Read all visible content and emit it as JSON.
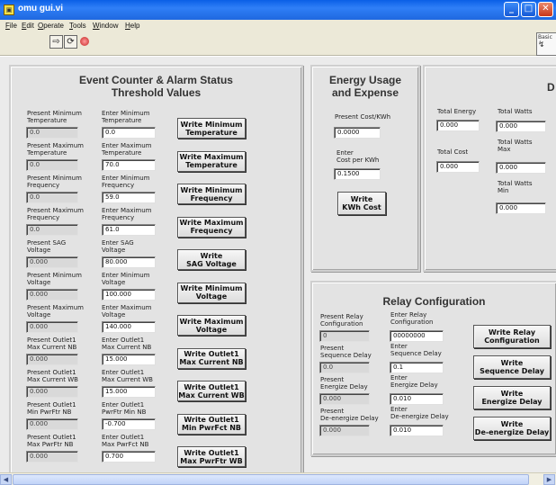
{
  "window": {
    "title": "omu gui.vi"
  },
  "menu": [
    "File",
    "Edit",
    "Operate",
    "Tools",
    "Window",
    "Help"
  ],
  "toolbar": {
    "palette_label": "Basic"
  },
  "event_panel": {
    "title": "Event Counter & Alarm Status\nThreshold Values",
    "rows": [
      {
        "present_label": "Present Minimum\nTemperature",
        "present_value": "0.0",
        "enter_label": "Enter Minimum\nTemperature",
        "enter_value": "0.0",
        "button": "Write Minimum\nTemperature"
      },
      {
        "present_label": "Present Maximum\nTemperature",
        "present_value": "0.0",
        "enter_label": "Enter Maximum\nTemperature",
        "enter_value": "70.0",
        "button": "Write Maximum\nTemperature"
      },
      {
        "present_label": "Present Minimum\nFrequency",
        "present_value": "0.0",
        "enter_label": "Enter Minimum\nFrequency",
        "enter_value": "59.0",
        "button": "Write Minimum\nFrequency"
      },
      {
        "present_label": "Present Maximum\nFrequency",
        "present_value": "0.0",
        "enter_label": "Enter Maximum\nFrequency",
        "enter_value": "61.0",
        "button": "Write Maximum\nFrequency"
      },
      {
        "present_label": "Present SAG\nVoltage",
        "present_value": "0.000",
        "enter_label": "Enter SAG\nVoltage",
        "enter_value": "80.000",
        "button": "Write\nSAG Voltage"
      },
      {
        "present_label": "Present Minimum\nVoltage",
        "present_value": "0.000",
        "enter_label": "Enter Minimum\nVoltage",
        "enter_value": "100.000",
        "button": "Write Minimum\nVoltage"
      },
      {
        "present_label": "Present Maximum\nVoltage",
        "present_value": "0.000",
        "enter_label": "Enter Maximum\nVoltage",
        "enter_value": "140.000",
        "button": "Write Maximum\nVoltage"
      },
      {
        "present_label": "Present Outlet1\nMax Current NB",
        "present_value": "0.000",
        "enter_label": "Enter Outlet1\nMax Current NB",
        "enter_value": "15.000",
        "button": "Write Outlet1\nMax Current NB"
      },
      {
        "present_label": "Present Outlet1\nMax Current WB",
        "present_value": "0.000",
        "enter_label": "Enter Outlet1\nMax Current WB",
        "enter_value": "15.000",
        "button": "Write Outlet1\nMax Current WB"
      },
      {
        "present_label": "Present Outlet1\nMin PwrFtr NB",
        "present_value": "0.000",
        "enter_label": "Enter Outlet1\nPwrFtr Min NB",
        "enter_value": "-0.700",
        "button": "Write Outlet1\nMin PwrFct NB"
      },
      {
        "present_label": "Present Outlet1\nMax PwrFtr NB",
        "present_value": "0.000",
        "enter_label": "Enter Outlet1\nMax PwrFct NB",
        "enter_value": "0.700",
        "button": "Write Outlet1\nMax PwrFtr WB"
      }
    ]
  },
  "energy_panel": {
    "title": "Energy Usage\nand Expense",
    "cost_label": "Present Cost/KWh",
    "cost_value": "0.0000",
    "enter_label": "Enter\nCost per KWh",
    "enter_value": "0.1500",
    "write_button": "Write\nKWh Cost"
  },
  "totals_panel": {
    "title_fragment": "D",
    "total_energy_label": "Total Energy",
    "total_energy_value": "0.000",
    "total_cost_label": "Total Cost",
    "total_cost_value": "0.000",
    "total_watts_label": "Total Watts",
    "total_watts_value": "0.000",
    "total_watts_max_label": "Total Watts\nMax",
    "total_watts_max_value": "0.000",
    "total_watts_min_label": "Total Watts\nMin",
    "total_watts_min_value": "0.000"
  },
  "relay_panel": {
    "title": "Relay Configuration",
    "rows": [
      {
        "present_label": "Present Relay\nConfiguration",
        "present_value": "0",
        "enter_label": "Enter Relay\nConfiguration",
        "enter_value": "00000000",
        "button": "Write Relay\nConfiguration"
      },
      {
        "present_label": "Present\nSequence Delay",
        "present_value": "0.0",
        "enter_label": "Enter\nSequence Delay",
        "enter_value": "0.1",
        "button": "Write\nSequence Delay"
      },
      {
        "present_label": "Present\nEnergize Delay",
        "present_value": "0.000",
        "enter_label": "Enter\nEnergize Delay",
        "enter_value": "0.010",
        "button": "Write\nEnergize Delay"
      },
      {
        "present_label": "Present\nDe-energize Delay",
        "present_value": "0.000",
        "enter_label": "Enter\nDe-energize Delay",
        "enter_value": "0.010",
        "button": "Write\nDe-energize Delay"
      }
    ]
  }
}
